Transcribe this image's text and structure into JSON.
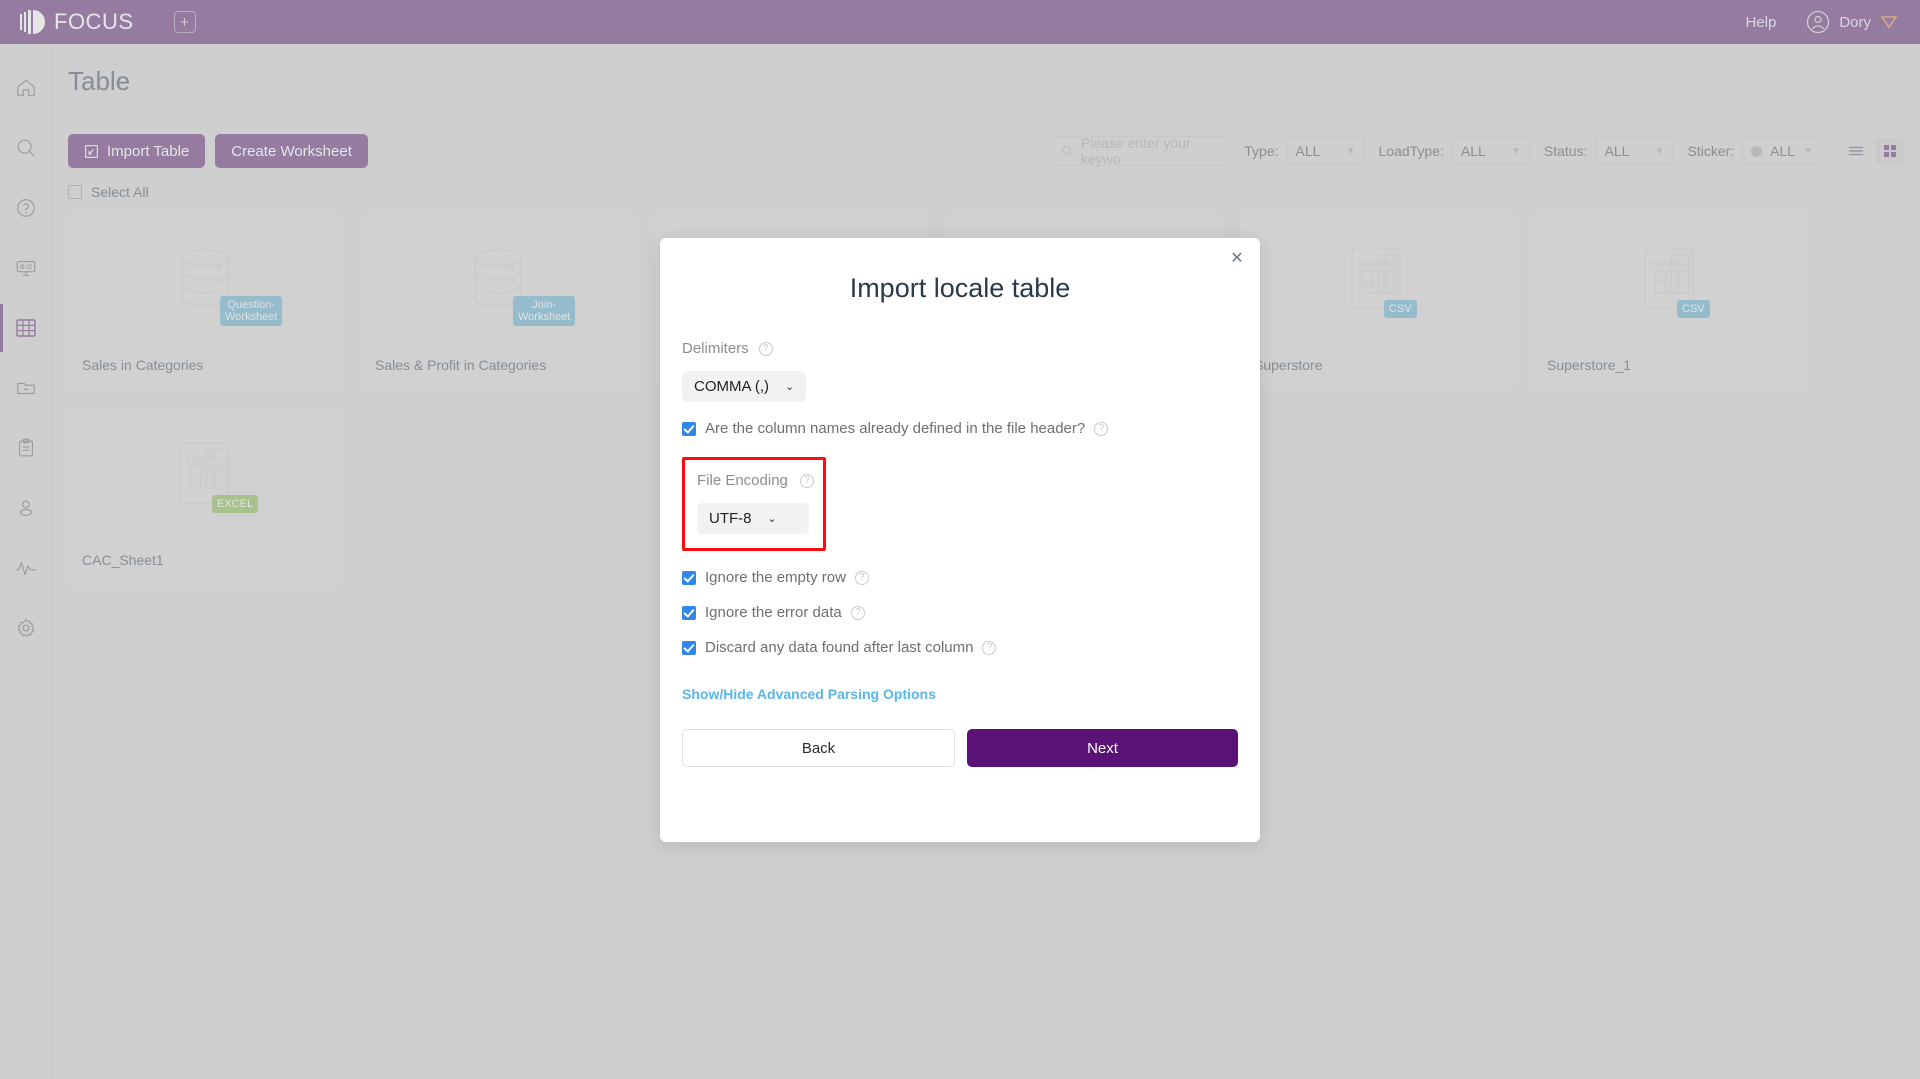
{
  "topbar": {
    "brand": "FOCUS",
    "add_tab_icon": "plus-square-icon",
    "help": "Help",
    "user_name": "Dory",
    "avatar_icon": "user-circle-icon",
    "badge_icon": "diamond-icon",
    "background": "#4a1263"
  },
  "sidebar": {
    "items": [
      {
        "name": "home",
        "icon": "home-icon",
        "active": false
      },
      {
        "name": "search",
        "icon": "search-icon",
        "active": false
      },
      {
        "name": "help",
        "icon": "question-circle-icon",
        "active": false
      },
      {
        "name": "dashboard",
        "icon": "presentation-icon",
        "active": false
      },
      {
        "name": "table",
        "icon": "table-grid-icon",
        "active": true
      },
      {
        "name": "folder",
        "icon": "folder-minus-icon",
        "active": false
      },
      {
        "name": "tasks",
        "icon": "clipboard-icon",
        "active": false
      },
      {
        "name": "users",
        "icon": "user-icon",
        "active": false
      },
      {
        "name": "monitor",
        "icon": "activity-pulse-icon",
        "active": false
      },
      {
        "name": "settings",
        "icon": "gear-icon",
        "active": false
      }
    ],
    "active_color": "#4a1263"
  },
  "page": {
    "title": "Table",
    "import_table_label": "Import Table",
    "import_icon": "import-arrow-icon",
    "create_worksheet_label": "Create Worksheet",
    "select_all_label": "Select All",
    "select_all_checked": false
  },
  "toolbar": {
    "search_placeholder": "Please enter your keywo",
    "search_icon": "search-icon",
    "filters": [
      {
        "label": "Type:",
        "value": "ALL"
      },
      {
        "label": "LoadType:",
        "value": "ALL"
      },
      {
        "label": "Status:",
        "value": "ALL"
      },
      {
        "label": "Sticker:",
        "value": "ALL",
        "dot": true
      }
    ],
    "view_list_icon": "list-view-icon",
    "view_grid_icon": "grid-view-icon",
    "active_view": "grid"
  },
  "cards": [
    {
      "name": "Sales in Categories",
      "art": "database-icon",
      "badge": "Question-\nWorksheet",
      "badge_color": "#4ba3c7"
    },
    {
      "name": "Sales & Profit in Categories",
      "art": "database-icon",
      "badge": "Join-\nWorksheet",
      "badge_color": "#4ba3c7"
    },
    {
      "name": "",
      "art": "none",
      "badge": "",
      "badge_color": ""
    },
    {
      "name": "",
      "art": "none",
      "badge": "",
      "badge_color": ""
    },
    {
      "name": "Superstore",
      "art": "import-file-icon",
      "badge": "CSV",
      "badge_color": "#4ba3c7"
    },
    {
      "name": "Superstore_1",
      "art": "import-file-icon",
      "badge": "CSV",
      "badge_color": "#4ba3c7"
    },
    {
      "name": "CAC_Sheet1",
      "art": "import-file-icon",
      "badge": "EXCEL",
      "badge_color": "#79ae33"
    }
  ],
  "card_art_label": "Import",
  "modal": {
    "title": "Import locale table",
    "close_icon": "close-icon",
    "delimiters_label": "Delimiters",
    "delimiters_value": "COMMA (,)",
    "header_checkbox_label": "Are the column names already defined in the file header?",
    "header_checkbox_checked": true,
    "file_encoding_label": "File Encoding",
    "file_encoding_value": "UTF-8",
    "highlight_color": "#fb0d0d",
    "ignore_empty_row_label": "Ignore the empty row",
    "ignore_empty_row_checked": true,
    "ignore_error_data_label": "Ignore the error data",
    "ignore_error_data_checked": true,
    "discard_after_last_column_label": "Discard any data found after last column",
    "discard_after_last_column_checked": true,
    "advanced_link": "Show/Hide Advanced Parsing Options",
    "back_label": "Back",
    "next_label": "Next",
    "next_color": "#5a1277",
    "help_icon": "question-circle-icon"
  }
}
